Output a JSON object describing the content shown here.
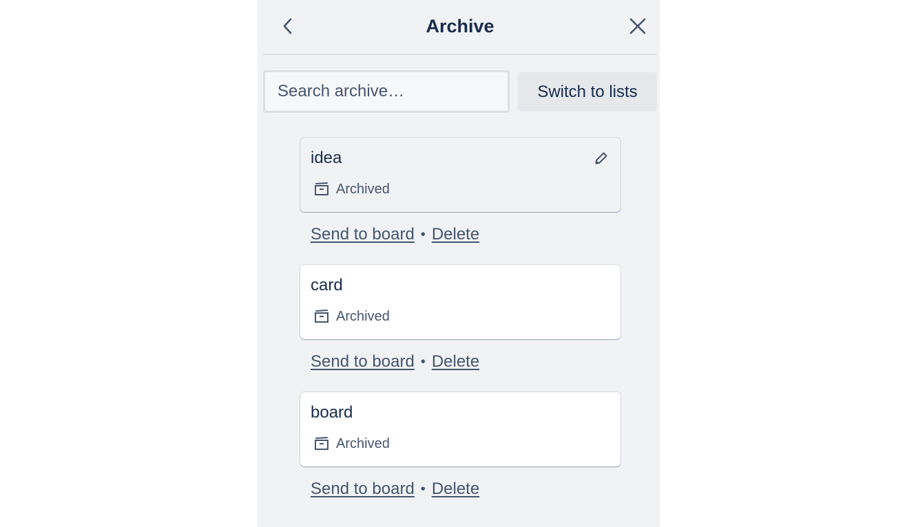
{
  "panel": {
    "title": "Archive",
    "back_icon": "chevron-left-icon",
    "close_icon": "close-icon"
  },
  "search": {
    "placeholder": "Search archive…",
    "value": ""
  },
  "toolbar": {
    "switch_label": "Switch to lists"
  },
  "items": [
    {
      "title": "idea",
      "badge": "Archived",
      "badge_icon": "archive-box-icon",
      "show_edit": true,
      "edit_icon": "pencil-icon",
      "send_label": "Send to board",
      "separator": "•",
      "delete_label": "Delete"
    },
    {
      "title": "card",
      "badge": "Archived",
      "badge_icon": "archive-box-icon",
      "show_edit": false,
      "send_label": "Send to board",
      "separator": "•",
      "delete_label": "Delete"
    },
    {
      "title": "board",
      "badge": "Archived",
      "badge_icon": "archive-box-icon",
      "show_edit": false,
      "send_label": "Send to board",
      "separator": "•",
      "delete_label": "Delete"
    }
  ],
  "colors": {
    "panel_bg": "#f1f2f4",
    "text_primary": "#172b4d",
    "text_subtle": "#44546f",
    "card_bg": "#ffffff"
  }
}
